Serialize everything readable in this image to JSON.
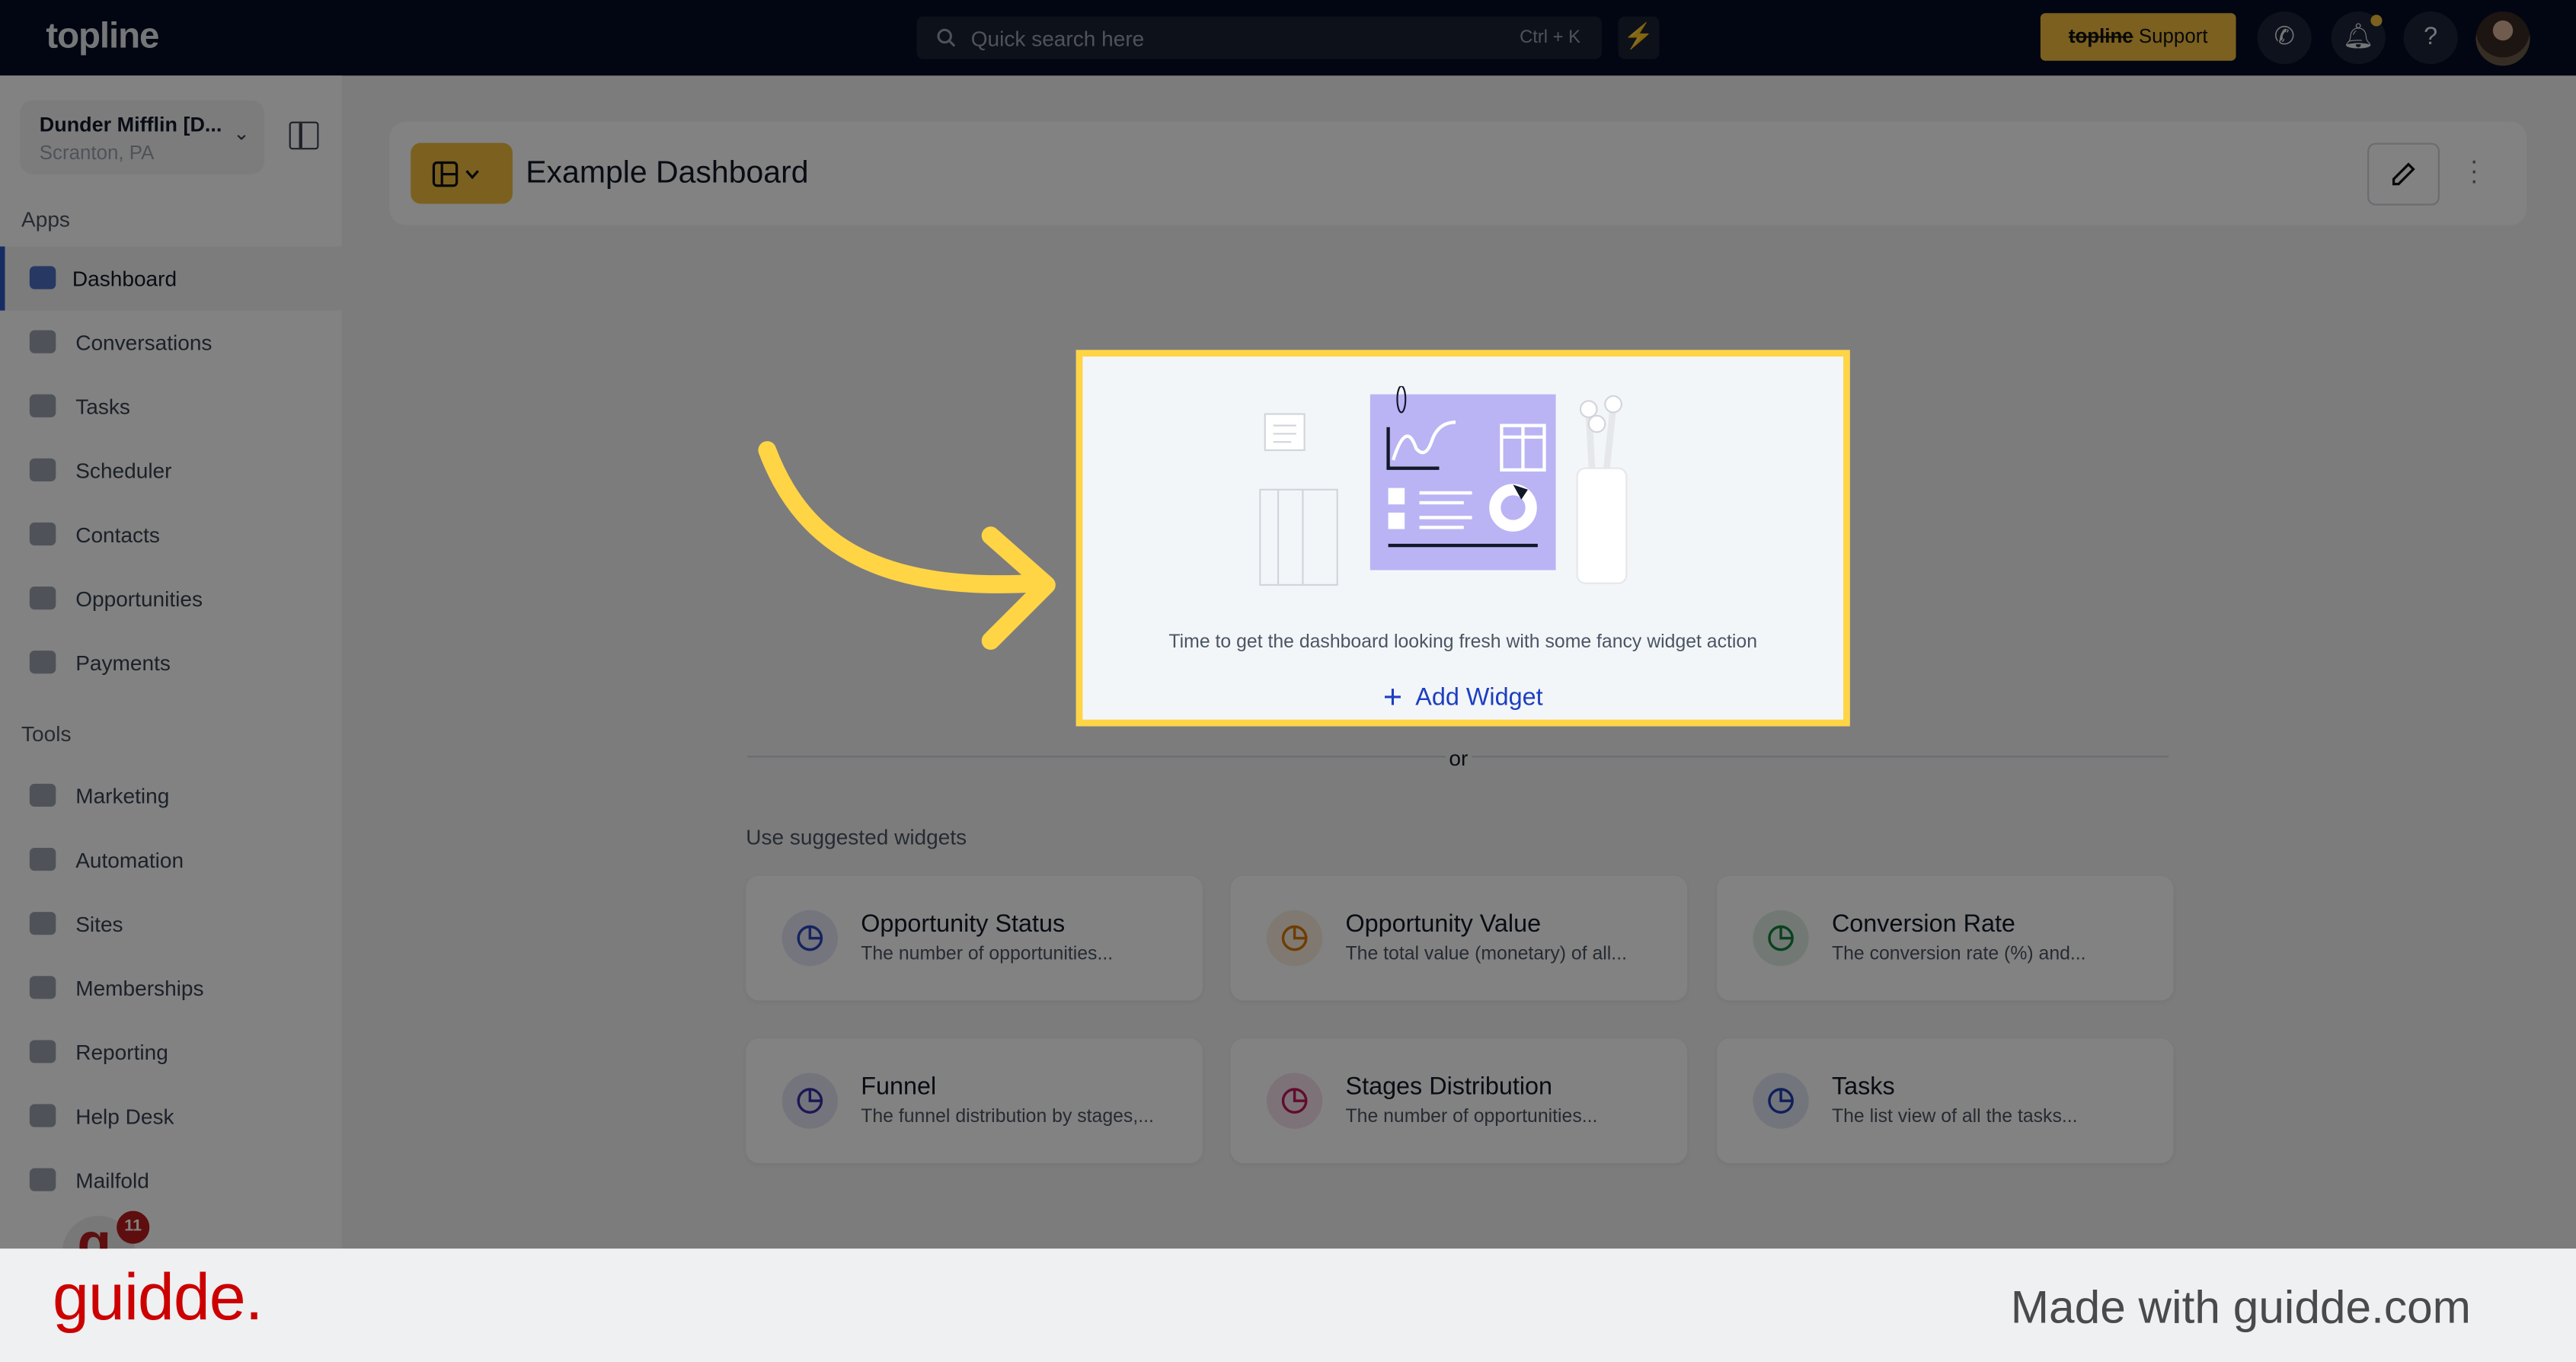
{
  "topbar": {
    "logo": "topline",
    "search_placeholder": "Quick search here",
    "search_shortcut": "Ctrl + K",
    "support_brand": "topline",
    "support_label": "Support",
    "notification_dot_color": "#f2bd3f"
  },
  "sidebar": {
    "org_name": "Dunder Mifflin [D...",
    "org_location": "Scranton, PA",
    "apps_label": "Apps",
    "apps": [
      {
        "label": "Dashboard",
        "icon": "dashboard-icon",
        "active": true
      },
      {
        "label": "Conversations",
        "icon": "chat-icon"
      },
      {
        "label": "Tasks",
        "icon": "task-icon"
      },
      {
        "label": "Scheduler",
        "icon": "calendar-icon"
      },
      {
        "label": "Contacts",
        "icon": "user-icon"
      },
      {
        "label": "Opportunities",
        "icon": "target-icon"
      },
      {
        "label": "Payments",
        "icon": "credit-card-icon"
      }
    ],
    "tools_label": "Tools",
    "tools": [
      {
        "label": "Marketing",
        "icon": "megaphone-icon"
      },
      {
        "label": "Automation",
        "icon": "gears-icon"
      },
      {
        "label": "Sites",
        "icon": "globe-icon"
      },
      {
        "label": "Memberships",
        "icon": "users-icon"
      },
      {
        "label": "Reporting",
        "icon": "pie-chart-icon"
      },
      {
        "label": "Help Desk",
        "icon": "help-icon"
      },
      {
        "label": "Mailfold",
        "icon": "mail-icon"
      }
    ],
    "badge_count": "11",
    "badge_letter": "g"
  },
  "header": {
    "title": "Example Dashboard"
  },
  "empty_state": {
    "message": "Time to get the dashboard looking fresh with some fancy widget action",
    "add_label": "Add Widget",
    "or_label": "or",
    "highlight_color": "#ffd445"
  },
  "suggested": {
    "label": "Use suggested widgets",
    "widgets": [
      {
        "title": "Opportunity Status",
        "desc": "The number of opportunities...",
        "icon": "pie-chart-icon",
        "color": "#2b45b8"
      },
      {
        "title": "Opportunity Value",
        "desc": "The total value (monetary) of all...",
        "icon": "award-icon",
        "color": "#d97706"
      },
      {
        "title": "Conversion Rate",
        "desc": "The conversion rate (%) and...",
        "icon": "pie-chart-icon",
        "color": "#15803d"
      },
      {
        "title": "Funnel",
        "desc": "The funnel distribution by stages,...",
        "icon": "funnel-icon",
        "color": "#3730a3"
      },
      {
        "title": "Stages Distribution",
        "desc": "The number of opportunities...",
        "icon": "pie-chart-icon",
        "color": "#be185d"
      },
      {
        "title": "Tasks",
        "desc": "The list view of all the tasks...",
        "icon": "clipboard-check-icon",
        "color": "#1e40af"
      }
    ]
  },
  "footer": {
    "logo": "guidde.",
    "made_with": "Made with guidde.com"
  }
}
